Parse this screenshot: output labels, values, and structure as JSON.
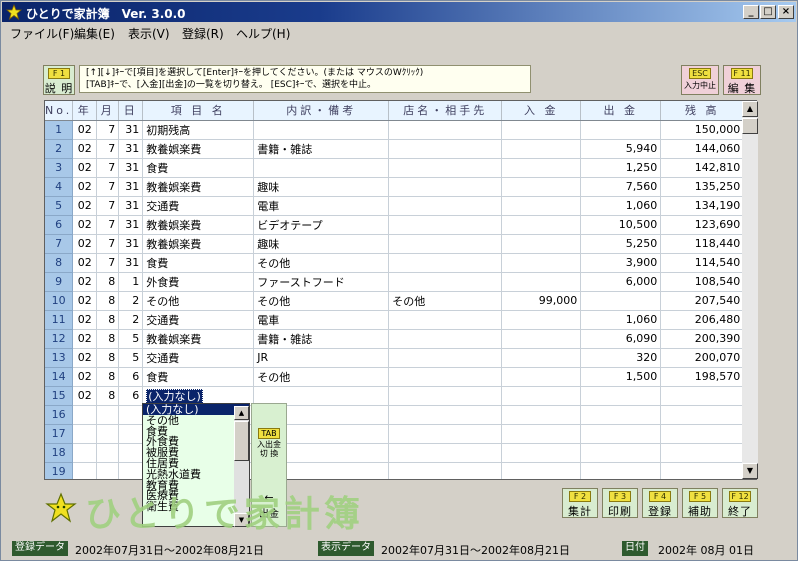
{
  "window": {
    "title": "ひとりで家計簿　Ver. 3.0.0"
  },
  "menu": [
    "ファイル(F)",
    "編集(E)",
    "表示(V)",
    "登録(R)",
    "ヘルプ(H)"
  ],
  "help_button": {
    "key": "F 1",
    "label": "説 明"
  },
  "hint": {
    "line1": "[↑][↓]ｷｰで[項目]を選択して[Enter]ｷｰを押してください。(または マウスのWｸﾘｯｸ)",
    "line2": "[TAB]ｷｰで、[入金][出金]の一覧を切り替え。 [ESC]ｷｰで、選択を中止。"
  },
  "top_buttons": [
    {
      "key": "ESC",
      "label": "入力中止"
    },
    {
      "key": "F 11",
      "label": "編 集"
    }
  ],
  "table": {
    "headers": [
      "No.",
      "年",
      "月",
      "日",
      "項 目 名",
      "内訳・備考",
      "店名・相手先",
      "入 金",
      "出 金",
      "残 高"
    ],
    "rows": [
      [
        "1",
        "02",
        "7",
        "31",
        "初期残高",
        "",
        "",
        "",
        "",
        "150,000"
      ],
      [
        "2",
        "02",
        "7",
        "31",
        "教養娯楽費",
        "書籍・雑誌",
        "",
        "",
        "5,940",
        "144,060"
      ],
      [
        "3",
        "02",
        "7",
        "31",
        "食費",
        "",
        "",
        "",
        "1,250",
        "142,810"
      ],
      [
        "4",
        "02",
        "7",
        "31",
        "教養娯楽費",
        "趣味",
        "",
        "",
        "7,560",
        "135,250"
      ],
      [
        "5",
        "02",
        "7",
        "31",
        "交通費",
        "電車",
        "",
        "",
        "1,060",
        "134,190"
      ],
      [
        "6",
        "02",
        "7",
        "31",
        "教養娯楽費",
        "ビデオテープ",
        "",
        "",
        "10,500",
        "123,690"
      ],
      [
        "7",
        "02",
        "7",
        "31",
        "教養娯楽費",
        "趣味",
        "",
        "",
        "5,250",
        "118,440"
      ],
      [
        "8",
        "02",
        "7",
        "31",
        "食費",
        "その他",
        "",
        "",
        "3,900",
        "114,540"
      ],
      [
        "9",
        "02",
        "8",
        "1",
        "外食費",
        "ファーストフード",
        "",
        "",
        "6,000",
        "108,540"
      ],
      [
        "10",
        "02",
        "8",
        "2",
        "その他",
        "その他",
        "その他",
        "99,000",
        "",
        "207,540"
      ],
      [
        "11",
        "02",
        "8",
        "2",
        "交通費",
        "電車",
        "",
        "",
        "1,060",
        "206,480"
      ],
      [
        "12",
        "02",
        "8",
        "5",
        "教養娯楽費",
        "書籍・雑誌",
        "",
        "",
        "6,090",
        "200,390"
      ],
      [
        "13",
        "02",
        "8",
        "5",
        "交通費",
        "JR",
        "",
        "",
        "320",
        "200,070"
      ],
      [
        "14",
        "02",
        "8",
        "6",
        "食費",
        "その他",
        "",
        "",
        "1,500",
        "198,570"
      ],
      [
        "15",
        "02",
        "8",
        "6",
        "(入力なし)",
        "",
        "",
        "",
        "",
        ""
      ],
      [
        "16",
        "",
        "",
        "",
        "",
        "",
        "",
        "",
        "",
        ""
      ],
      [
        "17",
        "",
        "",
        "",
        "",
        "",
        "",
        "",
        "",
        ""
      ],
      [
        "18",
        "",
        "",
        "",
        "",
        "",
        "",
        "",
        "",
        ""
      ],
      [
        "19",
        "",
        "",
        "",
        "",
        "",
        "",
        "",
        "",
        ""
      ]
    ]
  },
  "dropdown": {
    "options": [
      "(入力なし)",
      "その他",
      "食費",
      "外食費",
      "被服費",
      "住居費",
      "光熱水道費",
      "教育費",
      "医療費",
      "衛生費"
    ],
    "selected": 0,
    "tab_key": "TAB",
    "tab_label": "入出金\n切 換",
    "arrow": "←",
    "mode_label": "出金"
  },
  "logo": {
    "text": "ひとりで家計簿"
  },
  "fkeys": [
    {
      "key": "F 2",
      "label": "集計"
    },
    {
      "key": "F 3",
      "label": "印刷"
    },
    {
      "key": "F 4",
      "label": "登録"
    },
    {
      "key": "F 5",
      "label": "補助"
    },
    {
      "key": "F 12",
      "label": "終了"
    }
  ],
  "status": {
    "registered_label": "登録データ",
    "registered_value": "2002年07月31日～2002年08月21日",
    "display_label": "表示データ",
    "display_value": "2002年07月31日～2002年08月21日",
    "date_label": "日付",
    "date_value": "2002年 08月 01日"
  },
  "colors": {
    "accent": "#0a246a",
    "row_number": "#a8c8e8",
    "function_key": "#d8ecd0",
    "logo": "#a0d080"
  }
}
